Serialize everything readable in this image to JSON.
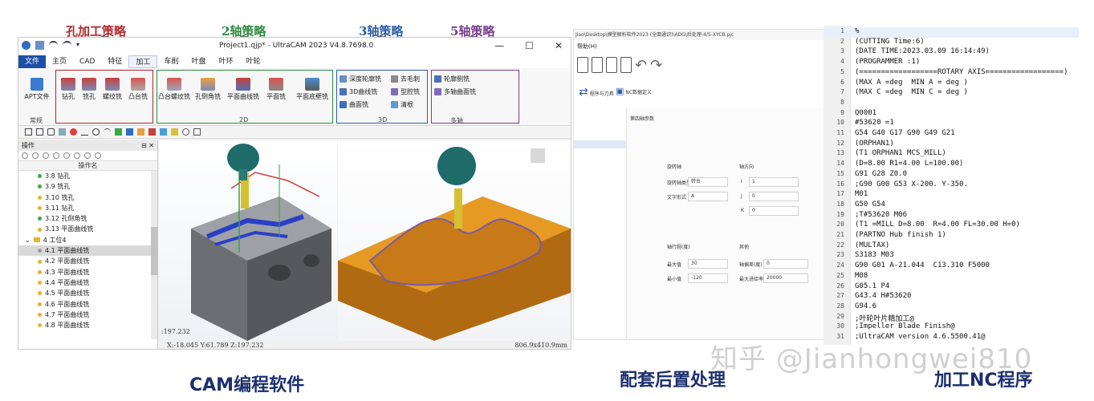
{
  "annotations": {
    "drilling": "孔加工策略",
    "axis2": "2轴策略",
    "axis3": "3轴策略",
    "axis5": "5轴策略"
  },
  "colors": {
    "drilling": "#b3282d",
    "axis2": "#2e8b3e",
    "axis3": "#2f5fa8",
    "axis5": "#7a3d8e",
    "caption": "#1c2f6e"
  },
  "cam": {
    "window_title": "Project1.qjp* - UltraCAM 2023 V4.8.7698.0",
    "window_controls": [
      "—",
      "☐",
      "✕"
    ],
    "menu": [
      "文件",
      "主页",
      "CAD",
      "特征",
      "加工",
      "车削",
      "叶盘",
      "叶环",
      "叶轮"
    ],
    "ribbon": {
      "apt": "APT文件",
      "group_common": "常规",
      "drilling_tools": [
        "钻孔",
        "铣孔",
        "螺纹铣",
        "凸台铣"
      ],
      "tools_2d": [
        "凸台螺纹铣",
        "孔倒角铣",
        "平面曲线铣",
        "平面铣",
        "平面底壁铣"
      ],
      "group_2d": "2D",
      "tools_3d": [
        "深度轮廓铣",
        "去毛刺",
        "3D曲线铣",
        "型腔铣",
        "曲面铣",
        "清根"
      ],
      "group_3d": "3D",
      "tools_multi": [
        "轮廓侧铣",
        "多轴曲面铣"
      ],
      "group_multi": "多轴"
    },
    "op_panel": {
      "title": "操作",
      "pin": "⊟ ✕",
      "column": "操作名",
      "items": [
        {
          "label": "3.8 钻孔",
          "color": "#3aa845"
        },
        {
          "label": "3.9 铣孔",
          "color": "#3aa845"
        },
        {
          "label": "3.10 铣孔",
          "color": "#e2b52c"
        },
        {
          "label": "3.11 钻孔",
          "color": "#e2b52c"
        },
        {
          "label": "3.12 孔倒角铣",
          "color": "#3aa845"
        },
        {
          "label": "3.13 平面曲线铣",
          "color": "#e2b52c"
        }
      ],
      "group": "4 工位4",
      "sub_items": [
        {
          "label": "4.1 平面曲线铣",
          "color": "#9a9a9a"
        },
        {
          "label": "4.2 平面曲线铣",
          "color": "#e2b52c"
        },
        {
          "label": "4.3 平面曲线铣",
          "color": "#e2b52c"
        },
        {
          "label": "4.4 平面曲线铣",
          "color": "#e2b52c"
        },
        {
          "label": "4.5 平面曲线铣",
          "color": "#e2b52c"
        },
        {
          "label": "4.6 平面曲线铣",
          "color": "#e2b52c"
        },
        {
          "label": "4.7 平面曲线铣",
          "color": "#e2b52c"
        },
        {
          "label": "4.8 平面曲线铣",
          "color": "#e2b52c"
        }
      ]
    },
    "status": {
      "coord_left": ":197.232",
      "coords": "X:-18.045  Y:61.789  Z:197.232",
      "zoom": "806.9x410.9mm"
    }
  },
  "post": {
    "path": "Jiao\\Desktop\\模型解析软件2023 (全面通识)\\ADG\\后处理-4/5-XYCB.pjc",
    "help": "帮助(H)",
    "tab1": "程序与刀具",
    "tab2": "NC数据定义",
    "section": "第四轴参数",
    "fields": {
      "rot_axis": "旋转轴",
      "axis_dir": "轴方向",
      "rot_type_lbl": "旋转轴类型",
      "rot_type_val": "转台",
      "text_lbl": "文字形式",
      "text_val": "A",
      "i_lbl": "I",
      "i_val": "1",
      "j_lbl": "J",
      "j_val": "0",
      "k_lbl": "K",
      "k_val": "0",
      "limit_lbl": "轴行程(度)",
      "other_lbl": "其他",
      "max_lbl": "最大值",
      "max_val": "30",
      "min_lbl": "最小值",
      "min_val": "-120",
      "tol_lbl": "轴偏差(度)",
      "tol_val": "0",
      "feed_lbl": "最大进给率",
      "feed_val": "20000"
    }
  },
  "nc": {
    "lines": [
      {
        "n": "1",
        "t": "%"
      },
      {
        "n": "2",
        "t": "(CUTTING Time:6)"
      },
      {
        "n": "3",
        "t": "(DATE TIME:2023.03.09 16:14:49)"
      },
      {
        "n": "4",
        "t": "(PROGRAMMER :1)"
      },
      {
        "n": "5",
        "t": "(==================ROTARY AXIS==================)"
      },
      {
        "n": "6",
        "t": "(MAX A =deg  MIN A = deg )"
      },
      {
        "n": "7",
        "t": "(MAX C =deg  MIN C = deg )"
      },
      {
        "n": "8",
        "t": ""
      },
      {
        "n": "9",
        "t": "O0001"
      },
      {
        "n": "10",
        "t": "#53620 =1"
      },
      {
        "n": "11",
        "t": "G54 G40 G17 G90 G49 G21"
      },
      {
        "n": "12",
        "t": "(ORPHAN1)"
      },
      {
        "n": "13",
        "t": "(T1 ORPHAN1 MCS_MILL)"
      },
      {
        "n": "14",
        "t": "(D=8.00 R1=4.00 L=100.00)"
      },
      {
        "n": "15",
        "t": "G91 G28 Z0.0"
      },
      {
        "n": "16",
        "t": ";G90 G00 G53 X-200. Y-350."
      },
      {
        "n": "17",
        "t": "M01"
      },
      {
        "n": "18",
        "t": "G50 G54"
      },
      {
        "n": "19",
        "t": ";T#53620 M06"
      },
      {
        "n": "20",
        "t": "(T1 =MILL D=8.00  R=4.00 FL=30.00 H=0)"
      },
      {
        "n": "21",
        "t": "(PARTNO Hub finish 1)"
      },
      {
        "n": "22",
        "t": "(MULTAX)"
      },
      {
        "n": "23",
        "t": "S3183 M03"
      },
      {
        "n": "24",
        "t": "G90 G01 A-21.044  C13.310 F5000"
      },
      {
        "n": "25",
        "t": "M08"
      },
      {
        "n": "26",
        "t": "G05.1 P4"
      },
      {
        "n": "27",
        "t": "G43.4 H#53620"
      },
      {
        "n": "28",
        "t": "G94.6"
      },
      {
        "n": "29",
        "t": ";叶轮叶片精加工@"
      },
      {
        "n": "30",
        "t": ";Impeller Blade Finish@"
      },
      {
        "n": "31",
        "t": ";UltraCAM version 4.6.5500.41@"
      }
    ]
  },
  "watermark": "知乎 @Jianhongwei810",
  "captions": {
    "cam": "CAM编程软件",
    "post": "配套后置处理",
    "nc": "加工NC程序"
  }
}
